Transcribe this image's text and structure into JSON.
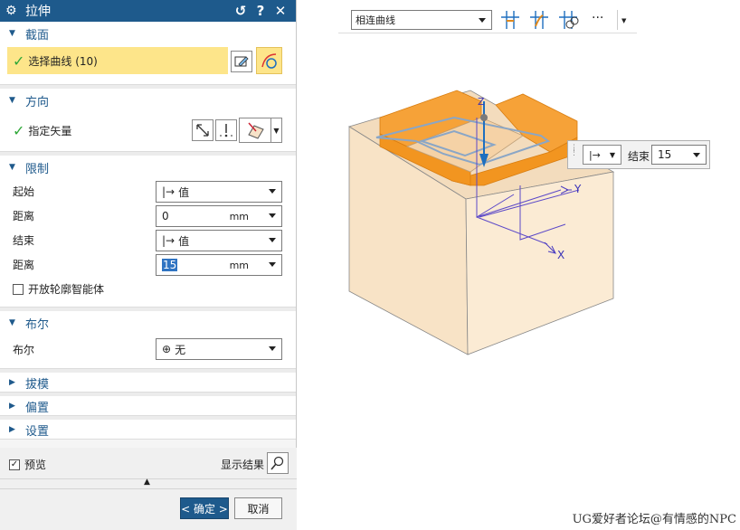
{
  "dialog": {
    "title": "拉伸",
    "reset_glyph": "↺",
    "help_glyph": "?",
    "close_glyph": "✕",
    "section_glyph": "⚙"
  },
  "section_profile": {
    "title": "截面",
    "select_curve": "选择曲线 (10)"
  },
  "section_direction": {
    "title": "方向",
    "specify_vector": "指定矢量"
  },
  "section_limits": {
    "title": "限制",
    "start_label": "起始",
    "start_value": "值",
    "start_distance_label": "距离",
    "start_distance": "0",
    "end_label": "结束",
    "end_value": "值",
    "end_distance_label": "距离",
    "end_distance": "15",
    "unit": "mm",
    "open_profile": "开放轮廓智能体"
  },
  "section_boolean": {
    "title": "布尔",
    "label": "布尔",
    "value": "无"
  },
  "section_draft": {
    "title": "拔模"
  },
  "section_offset": {
    "title": "偏置"
  },
  "section_settings": {
    "title": "设置"
  },
  "preview": {
    "label": "预览",
    "show_result": "显示结果"
  },
  "buttons": {
    "ok": "< 确定 >",
    "cancel": "取消"
  },
  "toolbar": {
    "curve_rule": "相连曲线",
    "more": "···"
  },
  "floating": {
    "end_label": "结束",
    "end_value": "15"
  },
  "axes": {
    "z": "Z",
    "y": "Y",
    "x": "X"
  },
  "watermark": "UG爱好者论坛@有情感的NPC",
  "colors": {
    "title_bar": "#1e5a8c",
    "highlight": "#fde58a",
    "extrusion": "#f29a1e",
    "block": "#f8e1c0"
  }
}
